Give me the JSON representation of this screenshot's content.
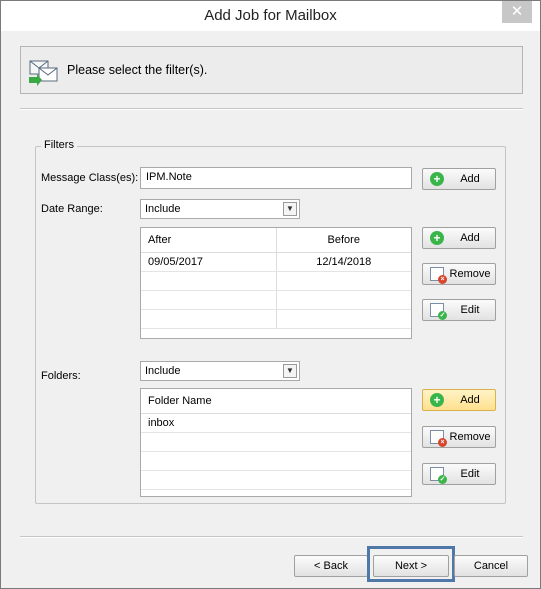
{
  "window": {
    "title": "Add Job for Mailbox",
    "close_glyph": "✕"
  },
  "header": {
    "text": "Please select the filter(s).",
    "icon": "mailbox-filter-icon"
  },
  "filters": {
    "legend": "Filters",
    "message_class": {
      "label": "Message Class(es):",
      "value": "IPM.Note",
      "add_label": "Add"
    },
    "date_range": {
      "label": "Date Range:",
      "mode": "Include",
      "columns": [
        "After",
        "Before"
      ],
      "rows": [
        {
          "after": "09/05/2017",
          "before": "12/14/2018"
        }
      ],
      "add_label": "Add",
      "remove_label": "Remove",
      "edit_label": "Edit"
    },
    "folders": {
      "label": "Folders:",
      "mode": "Include",
      "column": "Folder Name",
      "rows": [
        "inbox"
      ],
      "add_label": "Add",
      "remove_label": "Remove",
      "edit_label": "Edit"
    }
  },
  "footer": {
    "back_label": "< Back",
    "next_label": "Next >",
    "cancel_label": "Cancel"
  },
  "colors": {
    "accent_focus": "#4f78a8",
    "add_green": "#39b54a",
    "remove_red": "#d9442c"
  }
}
